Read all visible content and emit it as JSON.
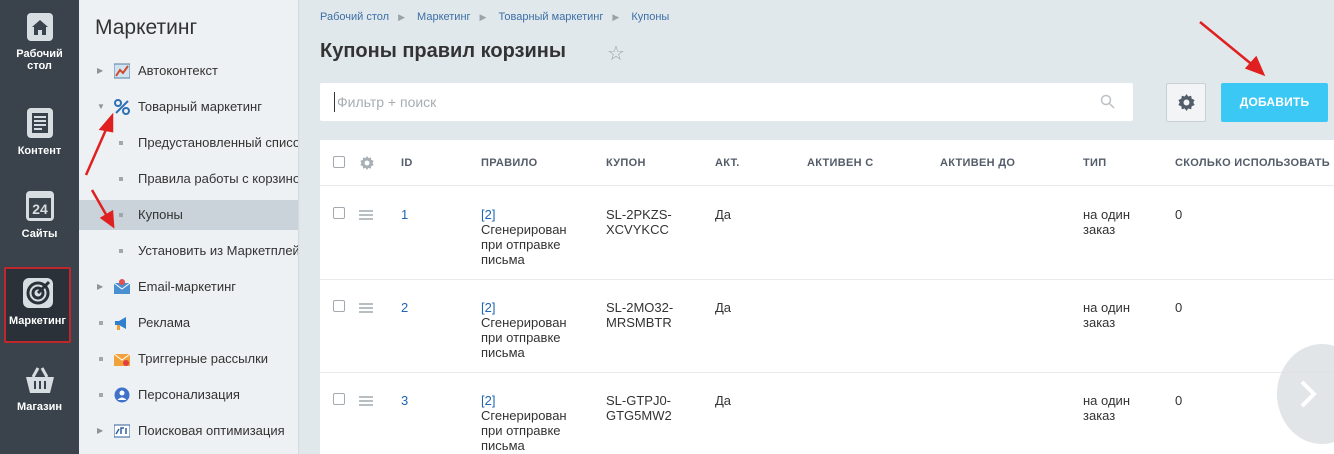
{
  "rail": {
    "items": [
      {
        "label": "Рабочий стол",
        "icon": "home-icon"
      },
      {
        "label": "Контент",
        "icon": "document-icon"
      },
      {
        "label": "Сайты",
        "icon": "calendar-24-icon"
      },
      {
        "label": "Маркетинг",
        "icon": "target-icon"
      },
      {
        "label": "Магазин",
        "icon": "basket-icon"
      }
    ],
    "labels": {
      "desktop_1": "Рабочий",
      "desktop_2": "стол",
      "content": "Контент",
      "sites": "Сайты",
      "sites_day": "24",
      "marketing": "Маркетинг",
      "shop": "Магазин"
    },
    "active_color": "#c0272d"
  },
  "sidebar": {
    "title": "Маркетинг",
    "items": [
      {
        "label": "Автоконтекст",
        "icon": "chart-icon"
      },
      {
        "label": "Товарный маркетинг",
        "icon": "percent-icon"
      },
      {
        "label": "Предустановленный список"
      },
      {
        "label": "Правила работы с корзиной"
      },
      {
        "label": "Купоны"
      },
      {
        "label": "Установить из Маркетплейса"
      },
      {
        "label": "Email-маркетинг",
        "icon": "email-icon"
      },
      {
        "label": "Реклама",
        "icon": "megaphone-icon"
      },
      {
        "label": "Триггерные рассылки",
        "icon": "envelope-trigger-icon"
      },
      {
        "label": "Персонализация",
        "icon": "person-icon"
      },
      {
        "label": "Поисковая оптимизация",
        "icon": "seo-icon"
      }
    ]
  },
  "breadcrumb": [
    "Рабочий стол",
    "Маркетинг",
    "Товарный маркетинг",
    "Купоны"
  ],
  "page": {
    "title": "Купоны правил корзины"
  },
  "filter": {
    "placeholder": "Фильтр + поиск",
    "value": ""
  },
  "toolbar": {
    "add_label": "ДОБАВИТЬ"
  },
  "colors": {
    "accent": "#3bc8f5",
    "link": "#2067b0",
    "rail": "#3a434b",
    "annotation": "#e02020"
  },
  "grid": {
    "columns": [
      "ID",
      "ПРАВИЛО",
      "КУПОН",
      "АКТ.",
      "АКТИВЕН С",
      "АКТИВЕН ДО",
      "ТИП",
      "СКОЛЬКО ИСПОЛЬЗОВАТЬ"
    ],
    "rows": [
      {
        "id": "1",
        "rule_1": "[2]",
        "rule_2": "Сгенерирован",
        "rule_3": "при отправке",
        "rule_4": "письма",
        "coupon_1": "SL-2PKZS-",
        "coupon_2": "XCVYKCC",
        "active": "Да",
        "from": "",
        "to": "",
        "type_1": "на один",
        "type_2": "заказ",
        "count": "0"
      },
      {
        "id": "2",
        "rule_1": "[2]",
        "rule_2": "Сгенерирован",
        "rule_3": "при отправке",
        "rule_4": "письма",
        "coupon_1": "SL-2MO32-",
        "coupon_2": "MRSMBTR",
        "active": "Да",
        "from": "",
        "to": "",
        "type_1": "на один",
        "type_2": "заказ",
        "count": "0"
      },
      {
        "id": "3",
        "rule_1": "[2]",
        "rule_2": "Сгенерирован",
        "rule_3": "при отправке",
        "rule_4": "письма",
        "coupon_1": "SL-GTPJ0-",
        "coupon_2": "GTG5MW2",
        "active": "Да",
        "from": "",
        "to": "",
        "type_1": "на один",
        "type_2": "заказ",
        "count": "0"
      }
    ]
  }
}
